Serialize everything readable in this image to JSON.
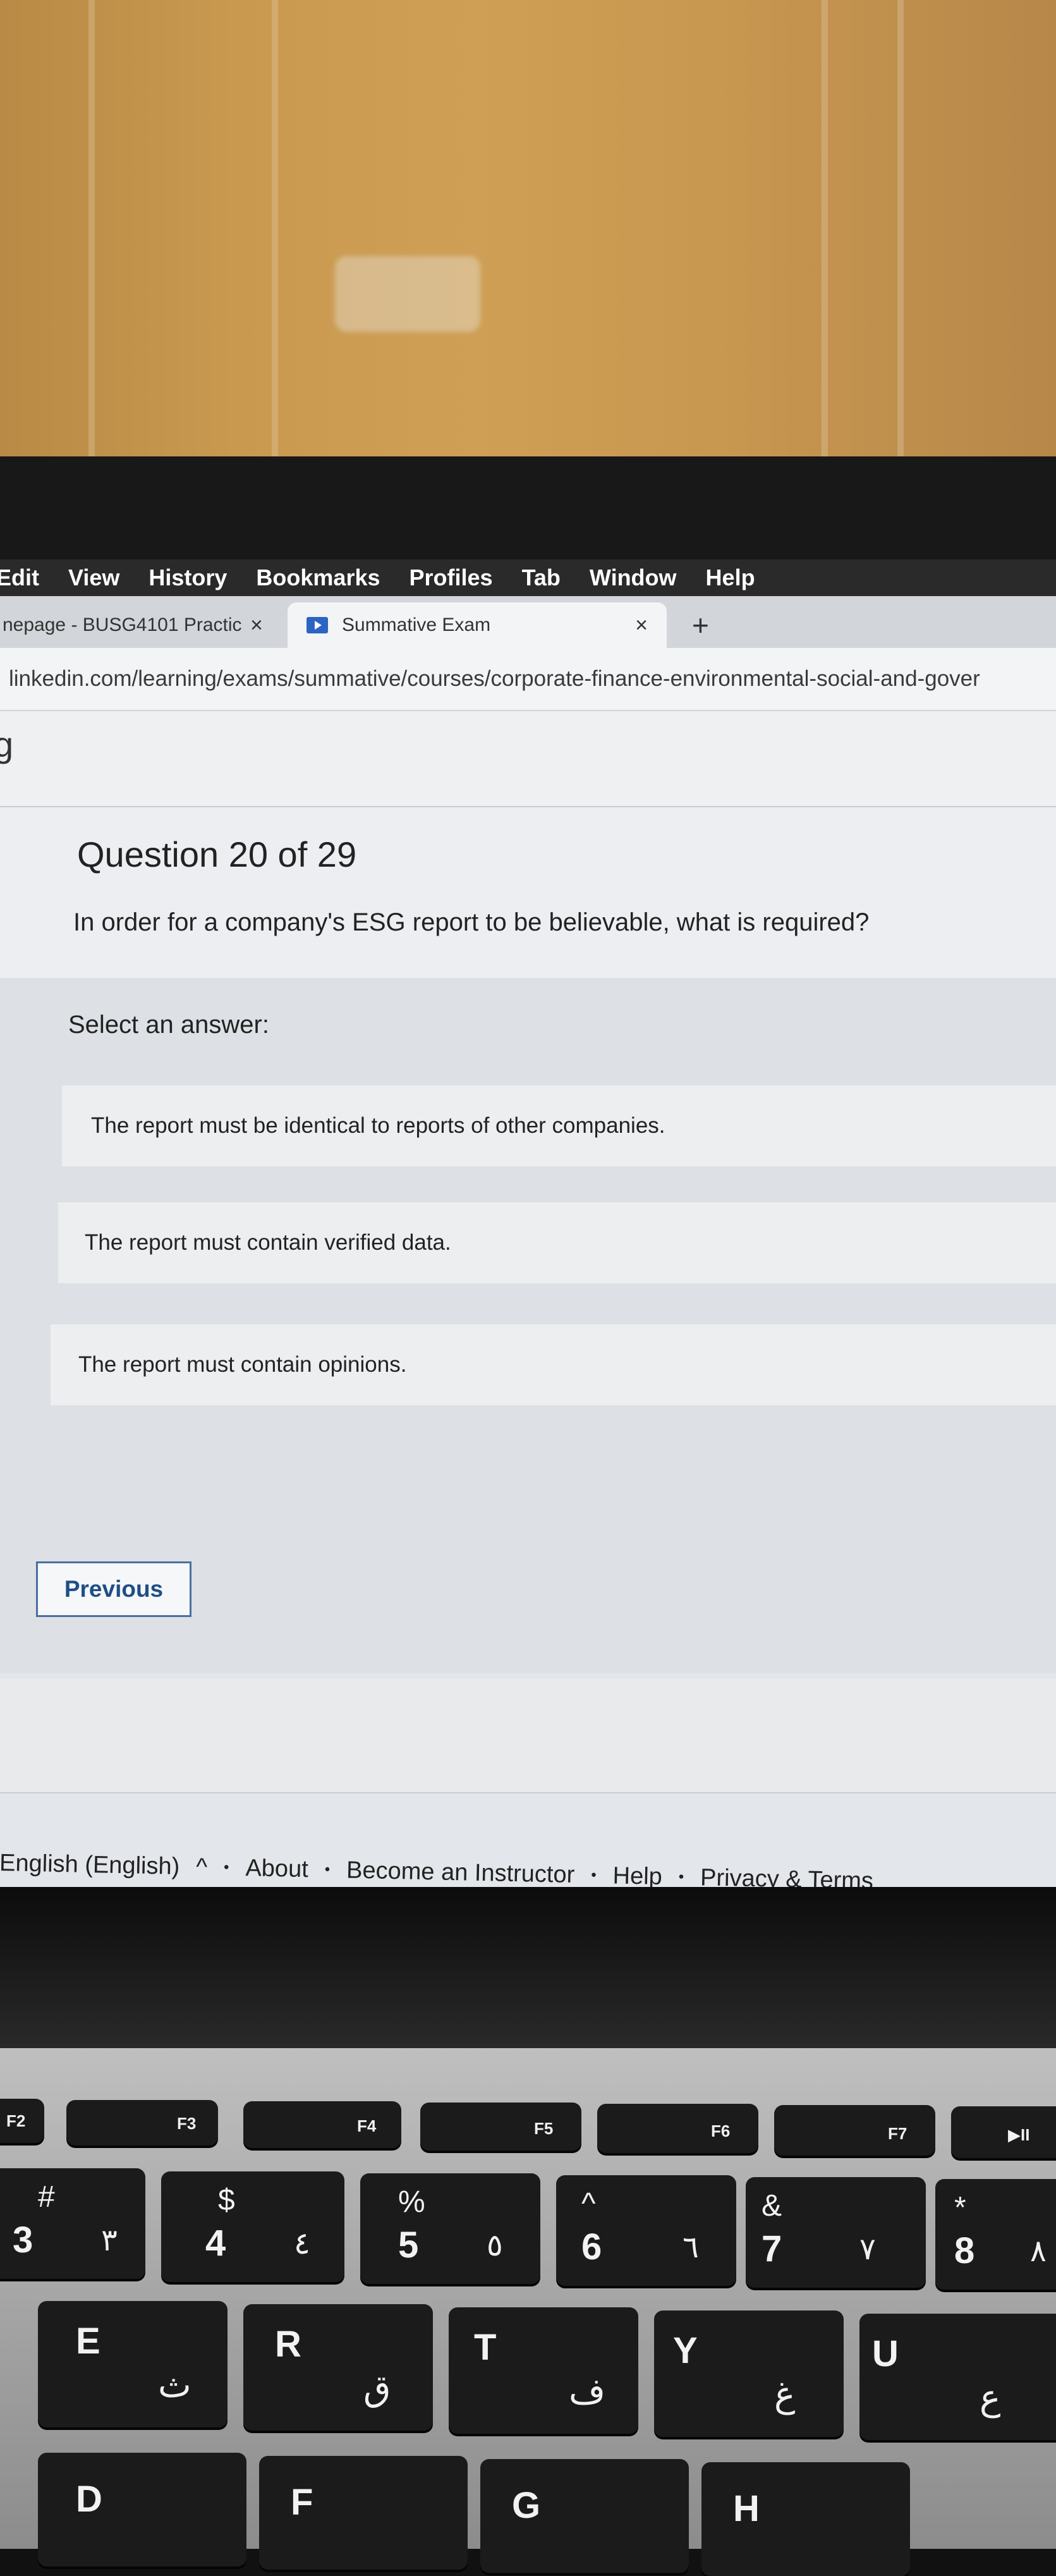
{
  "menubar": {
    "items": [
      "Edit",
      "View",
      "History",
      "Bookmarks",
      "Profiles",
      "Tab",
      "Window",
      "Help"
    ]
  },
  "tabs": [
    {
      "label": "nepage - BUSG4101 Practic",
      "close": "×"
    },
    {
      "label": "Summative Exam",
      "close": "×"
    }
  ],
  "new_tab": "+",
  "url": "linkedin.com/learning/exams/summative/courses/corporate-finance-environmental-social-and-gover",
  "logo_fragment": "g",
  "question": {
    "title": "Question 20 of 29",
    "text": "In order for a company's ESG report to be believable, what is required?"
  },
  "answers": {
    "prompt": "Select an answer:",
    "options": [
      "The report must be identical to reports of other companies.",
      "The report must contain verified data.",
      "The report must contain opinions."
    ]
  },
  "nav": {
    "previous": "Previous"
  },
  "footer": {
    "language": "English (English)",
    "language_chevron": "^",
    "links": [
      "About",
      "Become an Instructor",
      "Help",
      "Privacy & Terms"
    ],
    "separator": "•"
  },
  "keyboard": {
    "fkeys": [
      "F2",
      "F3",
      "F4",
      "F5",
      "F6",
      "F7",
      "▶II"
    ],
    "number_row": [
      {
        "sym": "#",
        "main": "3",
        "alt": "٣"
      },
      {
        "sym": "$",
        "main": "4",
        "alt": "٤"
      },
      {
        "sym": "%",
        "main": "5",
        "alt": "٥"
      },
      {
        "sym": "^",
        "main": "6",
        "alt": "٦"
      },
      {
        "sym": "&",
        "main": "7",
        "alt": "٧"
      },
      {
        "sym": "*",
        "main": "8",
        "alt": "٨"
      }
    ],
    "letter_row": [
      {
        "main": "E",
        "alt": "ث"
      },
      {
        "main": "R",
        "alt": "ق"
      },
      {
        "main": "T",
        "alt": "ف"
      },
      {
        "main": "Y",
        "alt": "غ"
      },
      {
        "main": "U",
        "alt": "ع"
      }
    ],
    "bottom_row": [
      "D",
      "F",
      "G",
      "H"
    ]
  }
}
